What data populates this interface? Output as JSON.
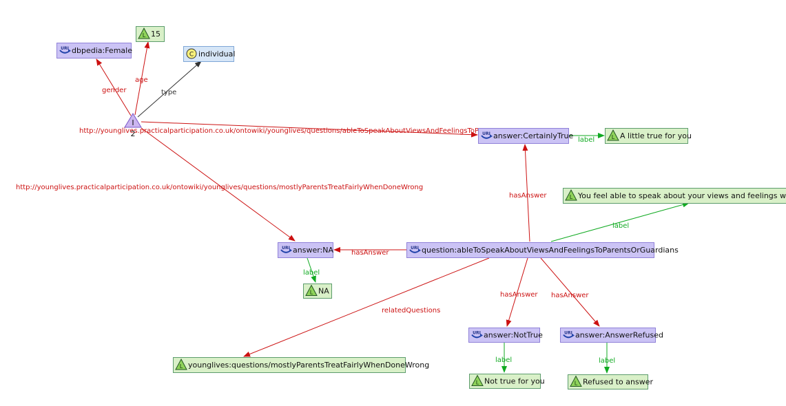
{
  "colors": {
    "uri_fill": "#cbc3f5",
    "uri_stroke": "#8f80d8",
    "literal_fill": "#d9f0c8",
    "literal_stroke": "#5c9c6c",
    "class_fill": "#d6e6f7",
    "class_stroke": "#7ea6d6",
    "edge_red": "#cc1111",
    "edge_green": "#11aa22",
    "edge_gray": "#333333"
  },
  "blank_node": {
    "id": "I",
    "glyph": "I",
    "count": "2"
  },
  "nodes": [
    {
      "id": "female",
      "kind": "uri",
      "label": "dbpedia:Female"
    },
    {
      "id": "age",
      "kind": "literal",
      "label": "15"
    },
    {
      "id": "individual",
      "kind": "class",
      "label": "individual"
    },
    {
      "id": "certainly",
      "kind": "uri",
      "label": "answer:CertainlyTrue"
    },
    {
      "id": "little",
      "kind": "literal",
      "label": "A little true for you"
    },
    {
      "id": "youfeel",
      "kind": "literal",
      "label": "You feel able to speak about your views and feelings with you"
    },
    {
      "id": "question",
      "kind": "uri",
      "label": "question:ableToSpeakAboutViewsAndFeelingsToParentsOrGuardians"
    },
    {
      "id": "na",
      "kind": "uri",
      "label": "answer:NA"
    },
    {
      "id": "nalit",
      "kind": "literal",
      "label": "NA"
    },
    {
      "id": "mostly",
      "kind": "literal",
      "label": "younglives:questions/mostlyParentsTreatFairlyWhenDoneWrong"
    },
    {
      "id": "nottrue",
      "kind": "uri",
      "label": "answer:NotTrue"
    },
    {
      "id": "refused",
      "kind": "uri",
      "label": "answer:AnswerRefused"
    },
    {
      "id": "nottruelit",
      "kind": "literal",
      "label": "Not true for you"
    },
    {
      "id": "refusedlit",
      "kind": "literal",
      "label": "Refused to answer"
    }
  ],
  "edges": [
    {
      "from": "I",
      "to": "female",
      "label": "gender",
      "color": "red"
    },
    {
      "from": "I",
      "to": "age",
      "label": "age",
      "color": "red"
    },
    {
      "from": "I",
      "to": "individual",
      "label": "type",
      "color": "gray"
    },
    {
      "from": "I",
      "to": "certainly",
      "label": "http://younglives.practicalparticipation.co.uk/ontowiki/younglives/questions/ableToSpeakAboutViewsAndFeelingsToPa",
      "color": "red"
    },
    {
      "from": "I",
      "to": "na",
      "label": "http://younglives.practicalparticipation.co.uk/ontowiki/younglives/questions/mostlyParentsTreatFairlyWhenDoneWrong",
      "color": "red"
    },
    {
      "from": "certainly",
      "to": "little",
      "label": "label",
      "color": "green"
    },
    {
      "from": "question",
      "to": "certainly",
      "label": "hasAnswer",
      "color": "red"
    },
    {
      "from": "question",
      "to": "youfeel",
      "label": "label",
      "color": "green"
    },
    {
      "from": "question",
      "to": "na",
      "label": "hasAnswer",
      "color": "red"
    },
    {
      "from": "na",
      "to": "nalit",
      "label": "label",
      "color": "green"
    },
    {
      "from": "question",
      "to": "mostly",
      "label": "relatedQuestions",
      "color": "red"
    },
    {
      "from": "question",
      "to": "nottrue",
      "label": "hasAnswer",
      "color": "red"
    },
    {
      "from": "question",
      "to": "refused",
      "label": "hasAnswer",
      "color": "red"
    },
    {
      "from": "nottrue",
      "to": "nottruelit",
      "label": "label",
      "color": "green"
    },
    {
      "from": "refused",
      "to": "refusedlit",
      "label": "label",
      "color": "green"
    }
  ]
}
